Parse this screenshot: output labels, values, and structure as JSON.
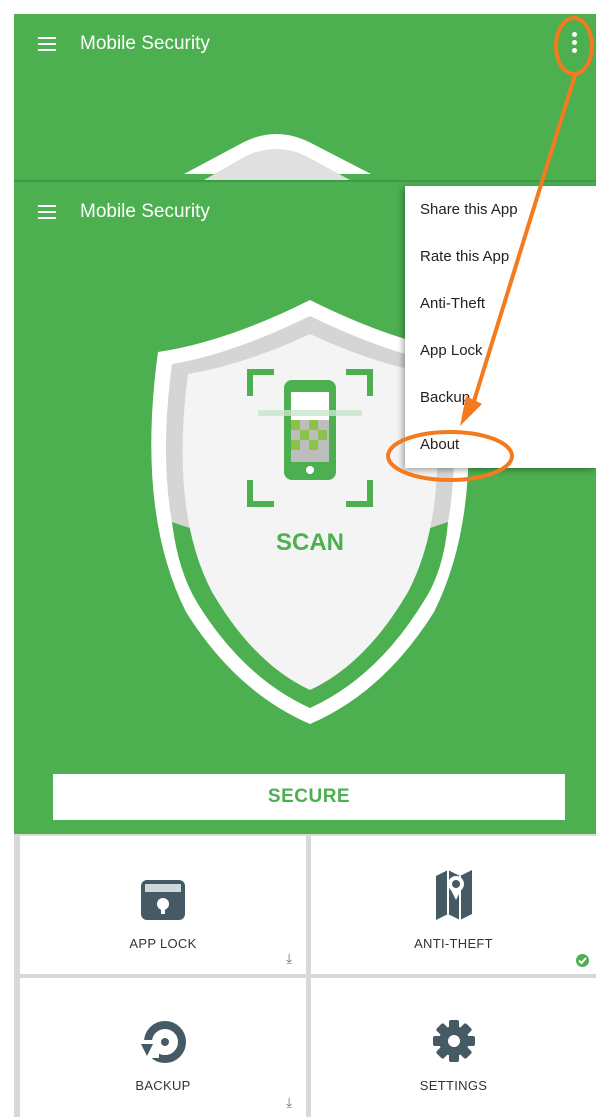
{
  "app": {
    "title": "Mobile Security"
  },
  "menu": {
    "items": [
      {
        "label": "Share this App"
      },
      {
        "label": "Rate this App"
      },
      {
        "label": "Anti-Theft"
      },
      {
        "label": "App Lock"
      },
      {
        "label": "Backup"
      },
      {
        "label": "About"
      }
    ]
  },
  "shield": {
    "scan_label": "SCAN"
  },
  "secure_button": {
    "label": "SECURE"
  },
  "features": [
    {
      "label": "APP LOCK",
      "icon": "app-lock-icon",
      "status": "download-icon"
    },
    {
      "label": "ANTI-THEFT",
      "icon": "anti-theft-map-icon",
      "status": "check-icon"
    },
    {
      "label": "BACKUP",
      "icon": "backup-icon",
      "status": "download-icon"
    },
    {
      "label": "SETTINGS",
      "icon": "gear-icon",
      "status": ""
    }
  ],
  "colors": {
    "primary_green": "#4caf50",
    "annotation_orange": "#f47a1f"
  }
}
